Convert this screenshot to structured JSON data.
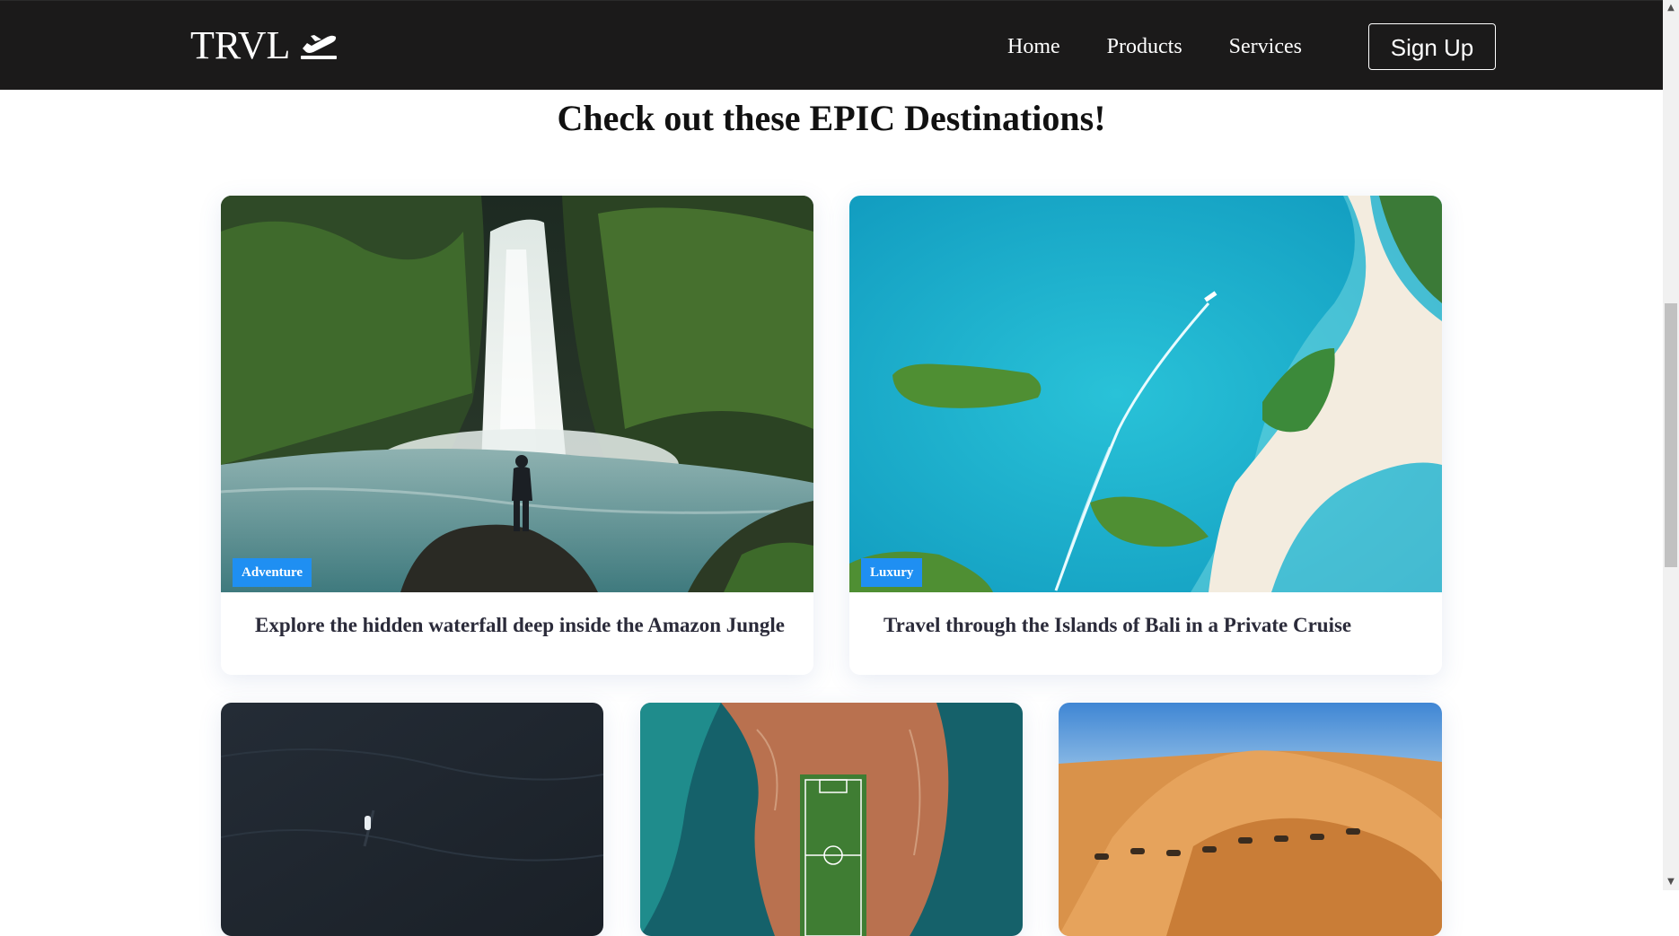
{
  "nav": {
    "logo_text": "TRVL",
    "logo_icon": "airplane-takeoff-icon",
    "links": [
      "Home",
      "Products",
      "Services"
    ],
    "signup_label": "Sign Up"
  },
  "heading": "Check out these EPIC Destinations!",
  "cards": [
    {
      "tag": "Adventure",
      "title": "Explore the hidden waterfall deep inside the Amazon Jungle",
      "image": "waterfall-photo"
    },
    {
      "tag": "Luxury",
      "title": "Travel through the Islands of Bali in a Private Cruise",
      "image": "aerial-islands-photo"
    },
    {
      "tag": "",
      "title": "",
      "image": "dark-ocean-boat-photo"
    },
    {
      "tag": "",
      "title": "",
      "image": "island-football-field-photo"
    },
    {
      "tag": "",
      "title": "",
      "image": "desert-camels-photo"
    }
  ],
  "colors": {
    "navbar": "#1b1a1a",
    "tag_background": "#1f8ff2",
    "card_title": "#2b2b3a",
    "heading": "#111111"
  }
}
